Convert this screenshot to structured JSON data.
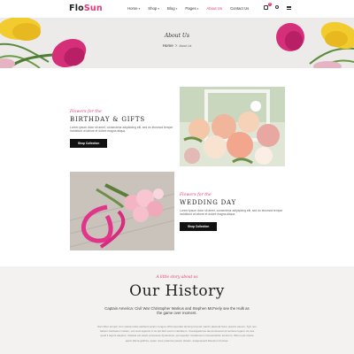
{
  "brand": {
    "name_prefix": "Flo",
    "name_suffix": "Sun",
    "accent": "#e23a78"
  },
  "nav": {
    "items": [
      {
        "label": "Home",
        "dropdown": true
      },
      {
        "label": "Shop",
        "dropdown": true
      },
      {
        "label": "Blog",
        "dropdown": true
      },
      {
        "label": "Pages",
        "dropdown": true
      },
      {
        "label": "About Us",
        "dropdown": false,
        "active": true
      },
      {
        "label": "Contact Us",
        "dropdown": false
      }
    ],
    "cart_count": "0",
    "caret": "▾"
  },
  "banner": {
    "title": "About Us",
    "crumb_home": "Home",
    "crumb_sep": ">",
    "crumb_current": "About Us"
  },
  "features": [
    {
      "kicker": "Flowers for the",
      "heading": "Birthday & Gifts",
      "body": "Lorem ipsum dolor sit amet, consectetur adipisicing elit, sed do eiusmod tempor incididunt ut labore et dolore magna aliqua.",
      "cta": "Shop Collection"
    },
    {
      "kicker": "Flowers for the",
      "heading": "Wedding Day",
      "body": "Lorem ipsum dolor sit amet, consectetur adipisicing elit, sed do eiusmod tempor incididunt ut labore et dolore magna aliqua.",
      "cta": "Shop Collection"
    }
  ],
  "history": {
    "kicker": "A little story about us",
    "title": "Our History",
    "lead": "Captain America: Civil War Christopher Markus and Stephen McFeely see the Hulk as the game over moment.",
    "body": "Nam liber tempor cum soluta nobis eleifend option congue nihil imperdiet doming id quod mazim placerat facer possim assum. Typi non habent claritatem insitam; est usus legentis in iis qui facit eorum claritatem. Investigationes demonstraverunt lectores legere me lius quod ii legunt saepius. Claritas est etiam processus dynamicus, qui sequitur mutationem consuetudium lectorum. Mirum est notare quam littera gothica, quam nunc putamus parum claram, anteposuerit litterarum formas."
  }
}
